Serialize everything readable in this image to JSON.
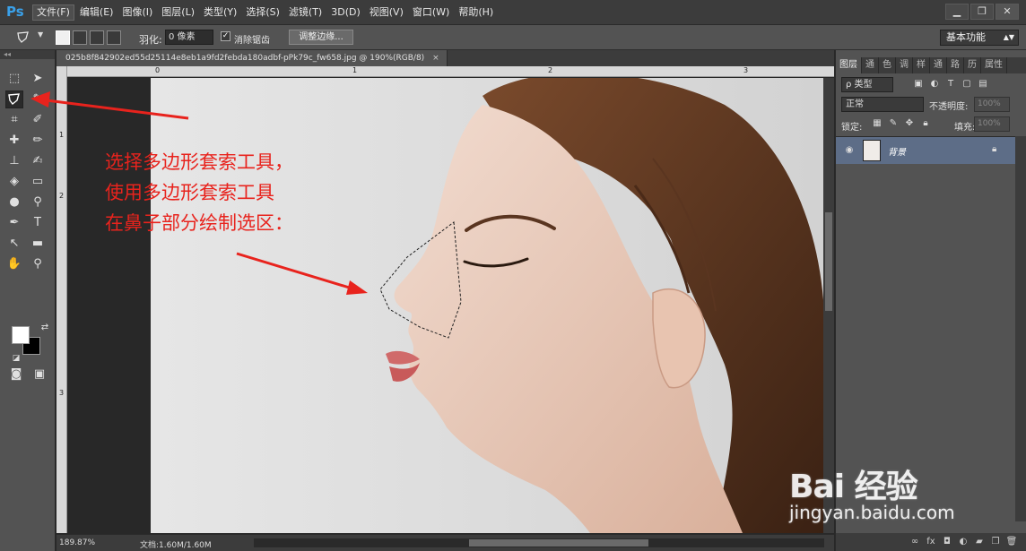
{
  "app": {
    "logo": "Ps",
    "menu": [
      "文件(F)",
      "编辑(E)",
      "图像(I)",
      "图层(L)",
      "类型(Y)",
      "选择(S)",
      "滤镜(T)",
      "3D(D)",
      "视图(V)",
      "窗口(W)",
      "帮助(H)"
    ],
    "window_controls": {
      "minimize": "▁",
      "restore": "❐",
      "close": "✕"
    }
  },
  "options": {
    "feather_label": "羽化:",
    "feather_value": "0 像素",
    "antialias_label": "消除锯齿",
    "antialias_checked": true,
    "refine_edge_label": "调整边缘...",
    "workspace": "基本功能"
  },
  "document": {
    "tab_title": "025b8f842902ed55d25114e8eb1a9fd2febda180adbf-pPk79c_fw658.jpg @ 190%(RGB/8)",
    "tab_close": "×",
    "ruler_h": [
      "0",
      "1",
      "2",
      "3"
    ],
    "ruler_v": [
      "1",
      "2",
      "3"
    ],
    "zoom": "189.87%",
    "doc_info": "文档:1.60M/1.60M"
  },
  "annotation": {
    "line1": "选择多边形套索工具，",
    "line2": "使用多边形套索工具",
    "line3": "在鼻子部分绘制选区：",
    "color": "#e8231d"
  },
  "layers_panel": {
    "tabs": [
      "图层",
      "通",
      "色",
      "调",
      "样",
      "通",
      "路",
      "历",
      "属性"
    ],
    "filter": "ρ 类型",
    "blend_mode": "正常",
    "opacity_label": "不透明度:",
    "opacity_value": "100%",
    "lock_label": "锁定:",
    "fill_label": "填充:",
    "fill_value": "100%",
    "layer_name": "背景"
  },
  "watermark": {
    "main": "Bai 经验",
    "sub": "jingyan.baidu.com"
  }
}
